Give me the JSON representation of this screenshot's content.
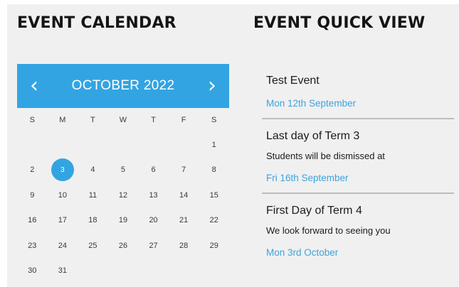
{
  "headings": {
    "calendar": "EVENT CALENDAR",
    "quick_view": "EVENT QUICK VIEW"
  },
  "calendar": {
    "month_label": "OCTOBER 2022",
    "prev_icon": "chevron-left-icon",
    "next_icon": "chevron-right-icon",
    "prev_glyph": "‹",
    "next_glyph": "›",
    "weekdays": [
      "S",
      "M",
      "T",
      "W",
      "T",
      "F",
      "S"
    ],
    "weeks": [
      [
        "",
        "",
        "",
        "",
        "",
        "",
        "1"
      ],
      [
        "2",
        "3",
        "4",
        "5",
        "6",
        "7",
        "8"
      ],
      [
        "9",
        "10",
        "11",
        "12",
        "13",
        "14",
        "15"
      ],
      [
        "16",
        "17",
        "18",
        "19",
        "20",
        "21",
        "22"
      ],
      [
        "23",
        "24",
        "25",
        "26",
        "27",
        "28",
        "29"
      ],
      [
        "30",
        "31",
        "",
        "",
        "",
        "",
        ""
      ]
    ],
    "selected_day": "3"
  },
  "events": [
    {
      "title": "Test Event",
      "description": "",
      "date": "Mon 12th September"
    },
    {
      "title": "Last day of Term 3",
      "description": "Students will be dismissed at",
      "date": "Fri 16th September"
    },
    {
      "title": "First Day of Term 4",
      "description": "We look forward to seeing you",
      "date": "Mon 3rd October"
    }
  ],
  "colors": {
    "accent": "#33a4e2",
    "date_text": "#3ea3dc",
    "panel_bg": "#f0f0f0"
  }
}
